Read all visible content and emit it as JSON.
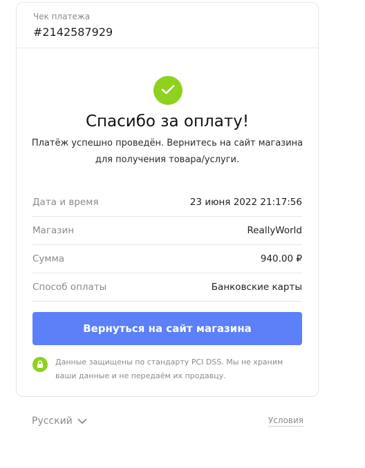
{
  "receipt": {
    "label": "Чек платежа",
    "number": "#2142587929"
  },
  "success": {
    "icon": "check-icon",
    "title": "Спасибо за оплату!",
    "text": "Платёж успешно проведён. Вернитесь на сайт магазина для получения товара/услуги."
  },
  "details": [
    {
      "label": "Дата и время",
      "value": "23 июня 2022 21:17:56"
    },
    {
      "label": "Магазин",
      "value": "ReallyWorld"
    },
    {
      "label": "Сумма",
      "value": "940.00 ₽"
    },
    {
      "label": "Способ оплаты",
      "value": "Банковские карты"
    }
  ],
  "actions": {
    "back_label": "Вернуться на сайт магазина"
  },
  "security": {
    "icon": "lock-icon",
    "text": "Данные защищены по стандарту PCI DSS. Мы не храним ваши данные и не передаём их продавцу."
  },
  "footer": {
    "language": "Русский",
    "terms": "Условия"
  },
  "colors": {
    "accent": "#5b80f7",
    "success": "#8fd11f"
  }
}
